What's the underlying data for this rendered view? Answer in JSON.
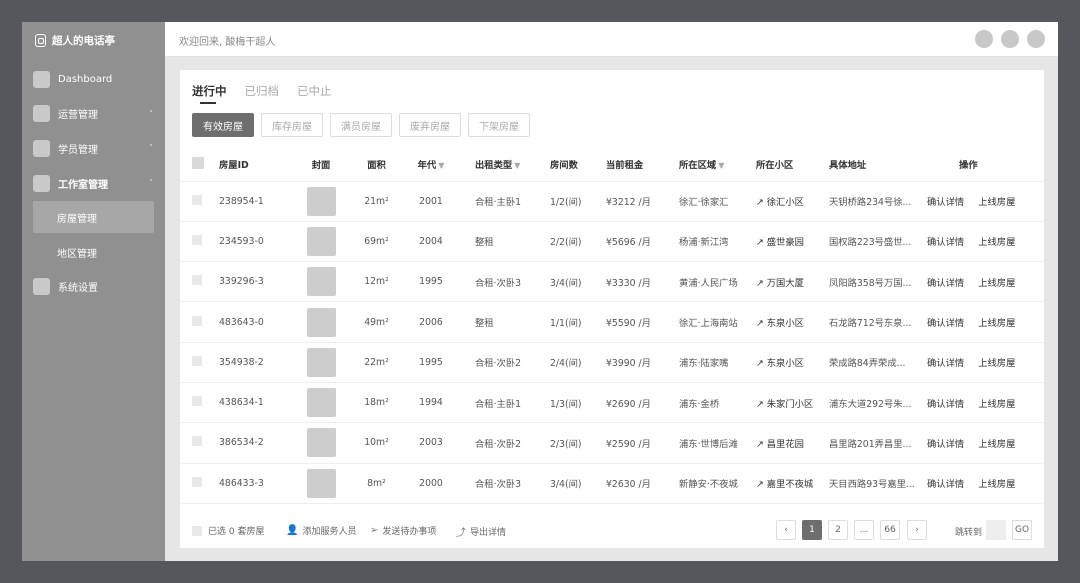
{
  "brand": {
    "name": "超人的电话亭"
  },
  "sidebar": {
    "items": [
      {
        "label": "Dashboard"
      },
      {
        "label": "运营管理",
        "chevron": "˅"
      },
      {
        "label": "学员管理",
        "chevron": "˅"
      },
      {
        "label": "工作室管理",
        "chevron": "˄"
      },
      {
        "label": "系统设置"
      }
    ],
    "subitems": [
      {
        "label": "房屋管理"
      },
      {
        "label": "地区管理"
      }
    ]
  },
  "header": {
    "welcome": "欢迎回来, 酸梅干超人"
  },
  "tabs": [
    "进行中",
    "已归档",
    "已中止"
  ],
  "filters": [
    "有效房屋",
    "库存房屋",
    "满员房屋",
    "废弃房屋",
    "下架房屋"
  ],
  "table": {
    "columns": [
      "房屋ID",
      "封面",
      "面积",
      "年代",
      "出租类型",
      "房间数",
      "当前租金",
      "所在区域",
      "所在小区",
      "具体地址",
      "操作"
    ],
    "filter_icon": "▼",
    "rows": [
      {
        "id": "238954-1",
        "area": "21m²",
        "year": "2001",
        "type": "合租·主卧1",
        "rooms": "1/2(间)",
        "rent": "¥3212 /月",
        "region": "徐汇·徐家汇",
        "community": "↗ 徐汇小区",
        "address": "天钥桥路234号徐...",
        "op1": "确认详情",
        "op2": "上线房屋"
      },
      {
        "id": "234593-0",
        "area": "69m²",
        "year": "2004",
        "type": "整租",
        "rooms": "2/2(间)",
        "rent": "¥5696 /月",
        "region": "杨浦·新江湾",
        "community": "↗ 盛世豪园",
        "address": "国权路223号盛世...",
        "op1": "确认详情",
        "op2": "上线房屋"
      },
      {
        "id": "339296-3",
        "area": "12m²",
        "year": "1995",
        "type": "合租·次卧3",
        "rooms": "3/4(间)",
        "rent": "¥3330 /月",
        "region": "黄浦·人民广场",
        "community": "↗ 万国大厦",
        "address": "凤阳路358号万国...",
        "op1": "确认详情",
        "op2": "上线房屋"
      },
      {
        "id": "483643-0",
        "area": "49m²",
        "year": "2006",
        "type": "整租",
        "rooms": "1/1(间)",
        "rent": "¥5590 /月",
        "region": "徐汇·上海南站",
        "community": "↗ 东泉小区",
        "address": "石龙路712号东泉...",
        "op1": "确认详情",
        "op2": "上线房屋"
      },
      {
        "id": "354938-2",
        "area": "22m²",
        "year": "1995",
        "type": "合租·次卧2",
        "rooms": "2/4(间)",
        "rent": "¥3990 /月",
        "region": "浦东·陆家嘴",
        "community": "↗ 东泉小区",
        "address": "荣成路84弄荣成...",
        "op1": "确认详情",
        "op2": "上线房屋"
      },
      {
        "id": "438634-1",
        "area": "18m²",
        "year": "1994",
        "type": "合租·主卧1",
        "rooms": "1/3(间)",
        "rent": "¥2690 /月",
        "region": "浦东·金桥",
        "community": "↗ 朱家门小区",
        "address": "浦东大道292号朱...",
        "op1": "确认详情",
        "op2": "上线房屋"
      },
      {
        "id": "386534-2",
        "area": "10m²",
        "year": "2003",
        "type": "合租·次卧2",
        "rooms": "2/3(间)",
        "rent": "¥2590 /月",
        "region": "浦东·世博后滩",
        "community": "↗ 昌里花园",
        "address": "昌里路201弄昌里...",
        "op1": "确认详情",
        "op2": "上线房屋"
      },
      {
        "id": "486433-3",
        "area": "8m²",
        "year": "2000",
        "type": "合租·次卧3",
        "rooms": "3/4(间)",
        "rent": "¥2630 /月",
        "region": "新静安·不夜城",
        "community": "↗ 嘉里不夜城",
        "address": "天目西路93号嘉里...",
        "op1": "确认详情",
        "op2": "上线房屋"
      }
    ]
  },
  "footer": {
    "selected": "已选 0 套房屋",
    "add_staff": "添加服务人员",
    "send_todo": "发送待办事项",
    "export": "导出详情",
    "icons": {
      "add_staff": "👤",
      "send_todo": "➢",
      "export": "⤴"
    }
  },
  "pagination": {
    "prev": "‹",
    "next": "›",
    "pages": [
      "1",
      "2",
      "...",
      "66"
    ],
    "jump_label": "跳转到",
    "go": "GO"
  }
}
